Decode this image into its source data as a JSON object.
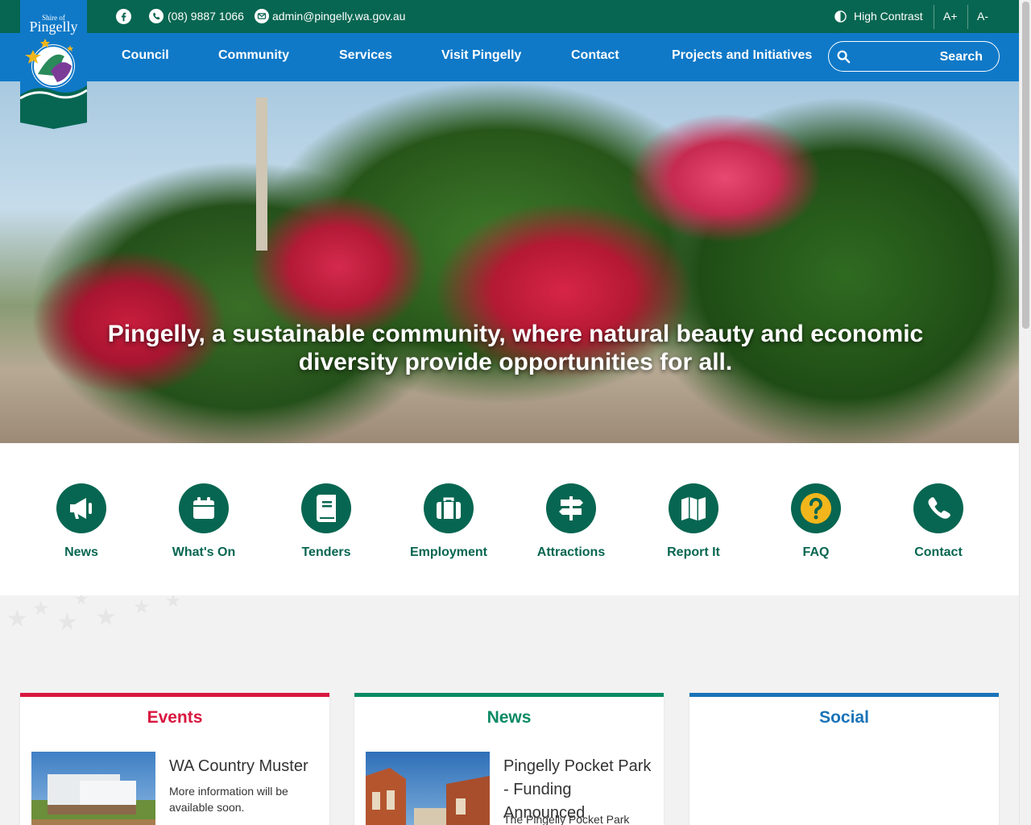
{
  "logo": {
    "text_top": "Shire of",
    "text_main": "Pingelly"
  },
  "topbar": {
    "facebook_icon": "facebook-icon",
    "phone": "(08) 9887 1066",
    "email": "admin@pingelly.wa.gov.au",
    "high_contrast": "High Contrast",
    "font_increase": "A+",
    "font_decrease": "A-"
  },
  "nav": {
    "items": [
      "Council",
      "Community",
      "Services",
      "Visit Pingelly",
      "Contact",
      "Projects and Initiatives"
    ],
    "search_label": "Search",
    "search_placeholder": ""
  },
  "hero": {
    "tagline": "Pingelly, a sustainable community, where natural beauty and economic diversity provide opportunities for all."
  },
  "quick_links": [
    {
      "label": "News",
      "icon": "megaphone-icon"
    },
    {
      "label": "What's On",
      "icon": "calendar-icon"
    },
    {
      "label": "Tenders",
      "icon": "book-icon"
    },
    {
      "label": "Employment",
      "icon": "briefcase-icon"
    },
    {
      "label": "Attractions",
      "icon": "signpost-icon"
    },
    {
      "label": "Report It",
      "icon": "map-icon"
    },
    {
      "label": "FAQ",
      "icon": "question-icon"
    },
    {
      "label": "Contact",
      "icon": "phone-icon"
    }
  ],
  "cards": {
    "events": {
      "heading": "Events",
      "title": "WA Country Muster",
      "body": "More information will be available soon.",
      "color": "#d9173f"
    },
    "news": {
      "heading": "News",
      "title": "Pingelly Pocket Park - Funding Announced",
      "body": "The Pingelly Pocket Park has",
      "color": "#0a8a64"
    },
    "social": {
      "heading": "Social",
      "color": "#1a73b8"
    }
  },
  "colors": {
    "dark_green": "#076651",
    "nav_blue": "#0f79c8",
    "yellow": "#f2b61c"
  }
}
